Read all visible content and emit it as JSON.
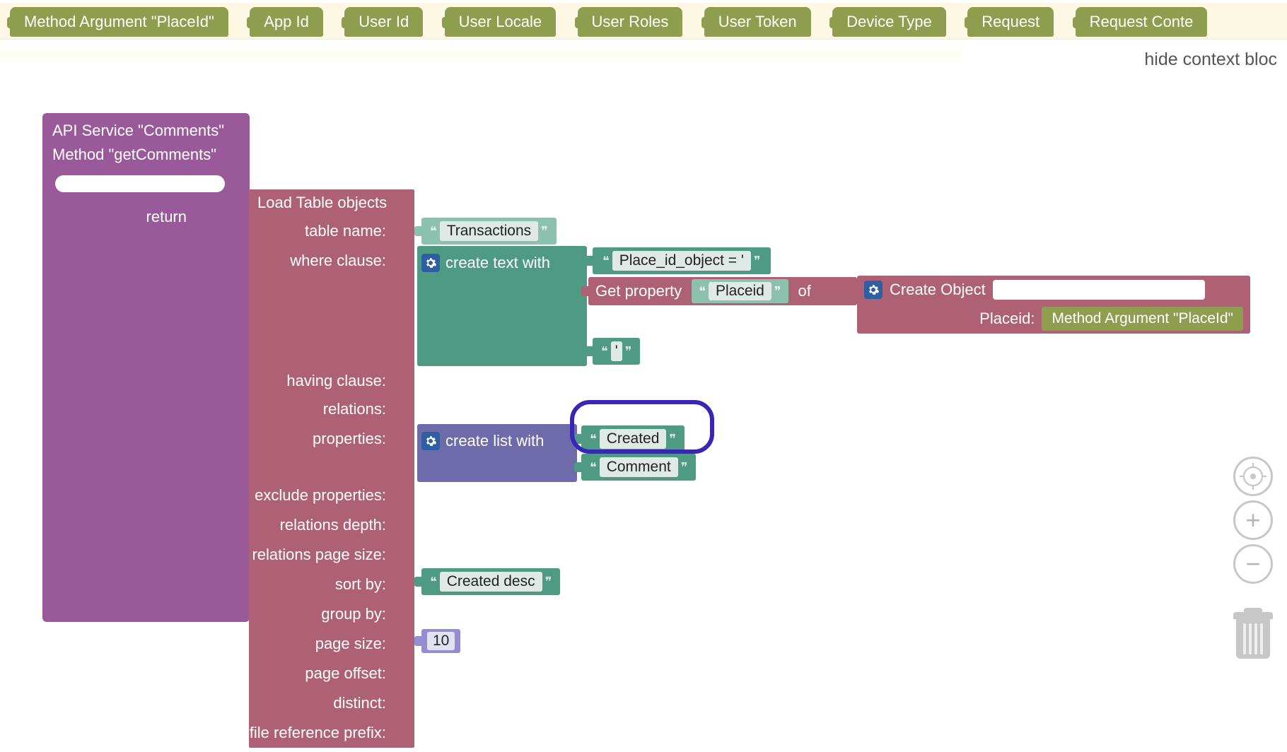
{
  "context_bar": {
    "items": [
      "Method Argument \"PlaceId\"",
      "App Id",
      "User Id",
      "User Locale",
      "User Roles",
      "User Token",
      "Device Type",
      "Request",
      "Request Conte"
    ]
  },
  "hide_link": "hide context bloc",
  "api_block": {
    "line1": "API Service \"Comments\"",
    "line2": "Method \"getComments\"",
    "return_label": "return"
  },
  "load_table": {
    "title": "Load Table objects",
    "rows": {
      "table_name": "table name:",
      "where_clause": "where clause:",
      "having_clause": "having clause:",
      "relations": "relations:",
      "properties": "properties:",
      "exclude_properties": "exclude properties:",
      "relations_depth": "relations depth:",
      "relations_page_size": "relations page size:",
      "sort_by": "sort by:",
      "group_by": "group by:",
      "page_size": "page size:",
      "page_offset": "page offset:",
      "distinct": "distinct:",
      "file_reference_prefix": "file reference prefix:"
    }
  },
  "values": {
    "table_name": "Transactions",
    "where_text_1": "Place_id_object = '",
    "where_text_3": "'",
    "get_property_label": "Get property",
    "get_property_value": "Placeid",
    "of_label": "of",
    "create_object_label": "Create Object",
    "create_object_field": "Placeid:",
    "create_object_arg": "Method Argument \"PlaceId\"",
    "create_text_with": "create text with",
    "create_list_with": "create list with",
    "prop_created": "Created",
    "prop_comment": "Comment",
    "sort_by": "Created desc",
    "page_size": "10"
  }
}
